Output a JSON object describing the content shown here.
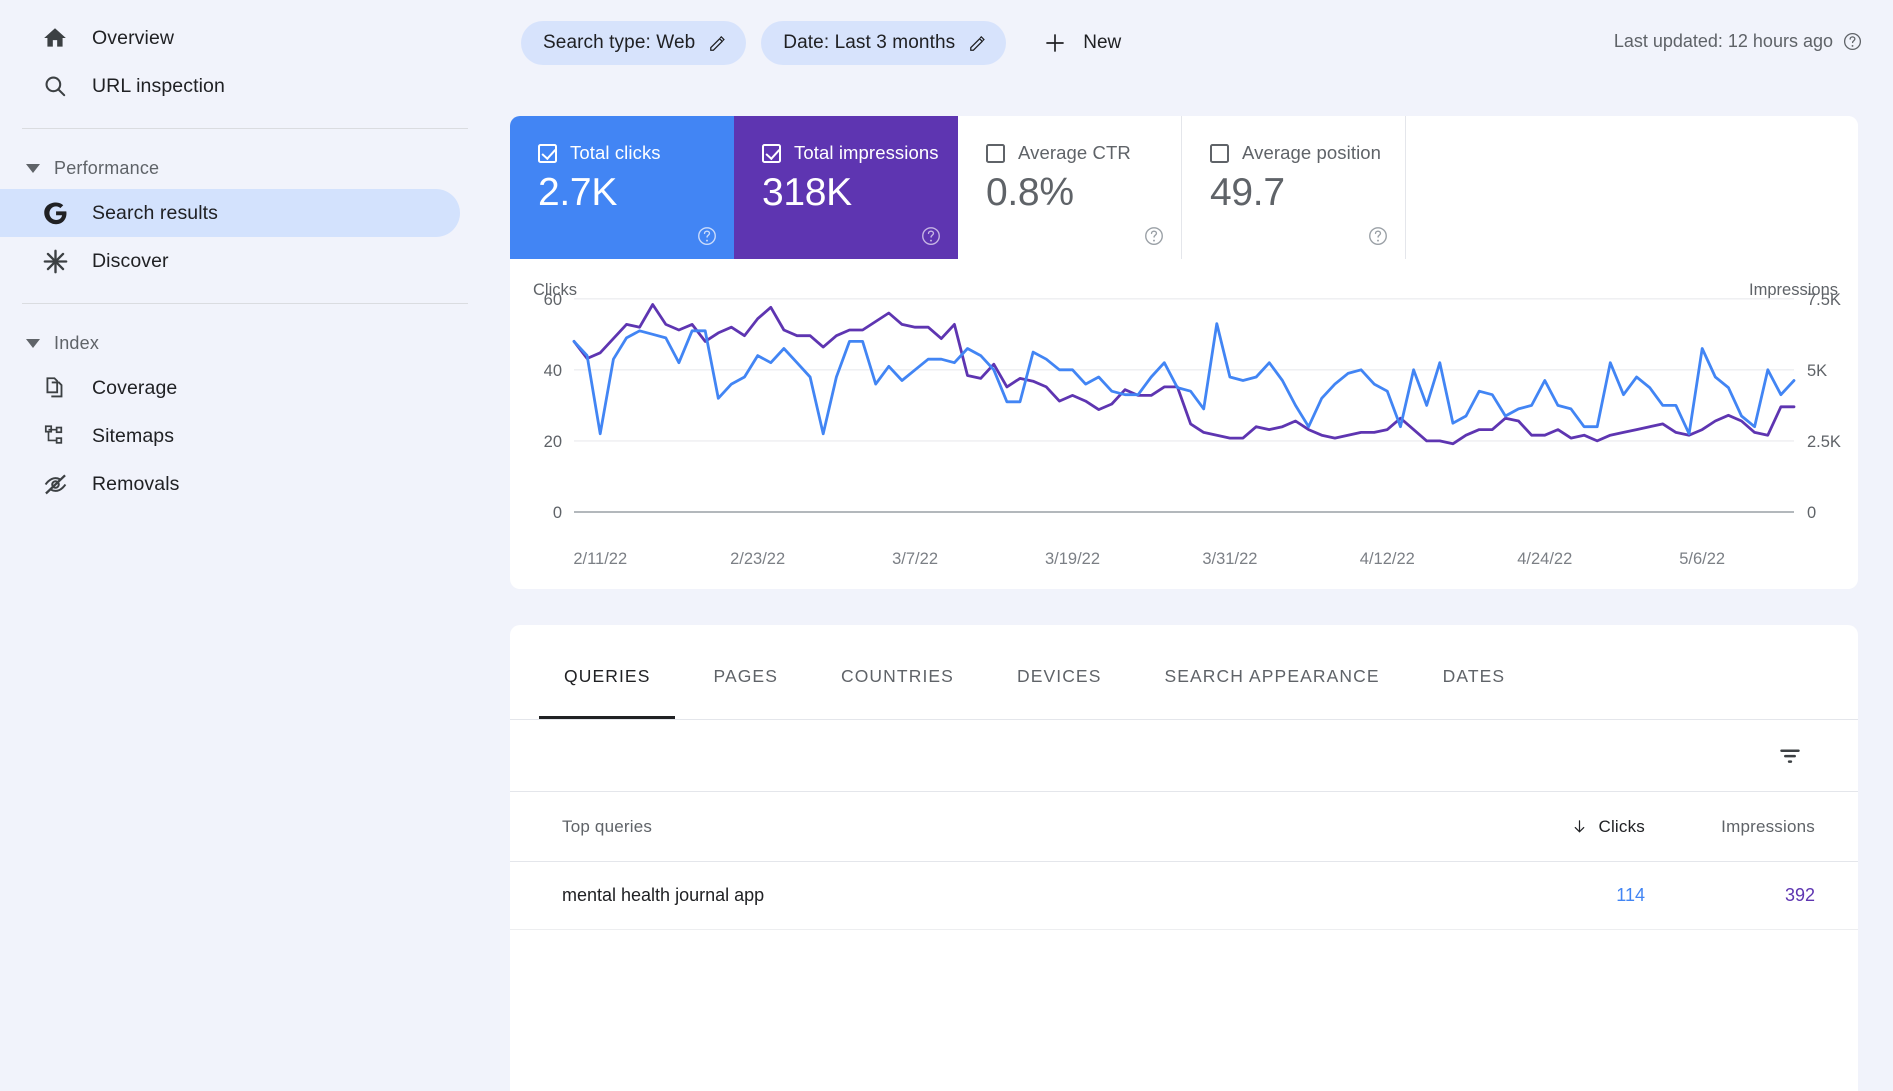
{
  "sidebar": {
    "items": [
      {
        "label": "Overview",
        "icon": "home-icon",
        "selected": false
      },
      {
        "label": "URL inspection",
        "icon": "search-icon",
        "selected": false
      }
    ],
    "sections": [
      {
        "label": "Performance",
        "items": [
          {
            "label": "Search results",
            "icon": "google-g-icon",
            "selected": true
          },
          {
            "label": "Discover",
            "icon": "asterisk-icon",
            "selected": false
          }
        ]
      },
      {
        "label": "Index",
        "items": [
          {
            "label": "Coverage",
            "icon": "documents-icon",
            "selected": false
          },
          {
            "label": "Sitemaps",
            "icon": "sitemap-icon",
            "selected": false
          },
          {
            "label": "Removals",
            "icon": "eye-off-icon",
            "selected": false
          }
        ]
      }
    ]
  },
  "filterbar": {
    "chips": [
      {
        "label": "Search type: Web",
        "icon": "pencil-icon"
      },
      {
        "label": "Date: Last 3 months",
        "icon": "pencil-icon"
      }
    ],
    "new_button": "New",
    "last_updated": "Last updated: 12 hours ago"
  },
  "metrics": [
    {
      "title": "Total clicks",
      "value": "2.7K",
      "checked": true,
      "style": "blue",
      "color": "#4285F4"
    },
    {
      "title": "Total impressions",
      "value": "318K",
      "checked": true,
      "style": "purple",
      "color": "#5E35B1"
    },
    {
      "title": "Average CTR",
      "value": "0.8%",
      "checked": false,
      "style": "plain",
      "color": "#5F6368"
    },
    {
      "title": "Average position",
      "value": "49.7",
      "checked": false,
      "style": "plain",
      "color": "#5F6368"
    }
  ],
  "chart_data": {
    "type": "line",
    "title": "",
    "xlabel": "",
    "grid": true,
    "legend_position": "none",
    "x_tick_labels": [
      "2/11/22",
      "2/23/22",
      "3/7/22",
      "3/19/22",
      "3/31/22",
      "4/12/22",
      "4/24/22",
      "5/6/22"
    ],
    "x_tick_indices": [
      2,
      14,
      26,
      38,
      50,
      62,
      74,
      86
    ],
    "axes": {
      "left": {
        "label": "Clicks",
        "ticks": [
          "0",
          "20",
          "40",
          "60"
        ],
        "tickvals": [
          0,
          20,
          40,
          60
        ],
        "ylim": [
          0,
          65
        ]
      },
      "right": {
        "label": "Impressions",
        "ticks": [
          "0",
          "2.5K",
          "5K",
          "7.5K"
        ],
        "tickvals": [
          0,
          2500,
          5000,
          7500
        ],
        "ylim": [
          0,
          8125
        ]
      }
    },
    "series": [
      {
        "name": "Clicks",
        "axis": "left",
        "color": "#4285F4",
        "values": [
          48,
          44,
          22,
          43,
          49,
          51,
          50,
          49,
          42,
          51,
          51,
          32,
          36,
          38,
          44,
          42,
          46,
          42,
          38,
          22,
          38,
          48,
          48,
          36,
          41,
          37,
          40,
          43,
          43,
          42,
          46,
          44,
          40,
          31,
          31,
          45,
          43,
          40,
          40,
          36,
          38,
          34,
          33,
          33,
          38,
          42,
          35,
          34,
          29,
          53,
          38,
          37,
          38,
          42,
          37,
          30,
          24,
          32,
          36,
          39,
          40,
          36,
          34,
          24,
          40,
          30,
          42,
          25,
          27,
          34,
          33,
          27,
          29,
          30,
          37,
          30,
          29,
          24,
          24,
          42,
          33,
          38,
          35,
          30,
          30,
          22,
          46,
          38,
          35,
          27,
          24,
          40,
          33,
          37
        ],
        "min": 22,
        "max": 53
      },
      {
        "name": "Impressions",
        "axis": "right",
        "color": "#5E35B1",
        "values": [
          6000,
          5400,
          5600,
          6100,
          6600,
          6500,
          7300,
          6600,
          6400,
          6600,
          6000,
          6300,
          6500,
          6200,
          6800,
          7200,
          6400,
          6200,
          6200,
          5800,
          6200,
          6400,
          6400,
          6700,
          7000,
          6600,
          6500,
          6500,
          6100,
          6600,
          4800,
          4700,
          5200,
          4400,
          4700,
          4600,
          4400,
          3900,
          4100,
          3900,
          3600,
          3800,
          4300,
          4100,
          4100,
          4400,
          4400,
          3100,
          2800,
          2700,
          2600,
          2600,
          3000,
          2900,
          3000,
          3200,
          2900,
          2700,
          2600,
          2700,
          2800,
          2800,
          2900,
          3300,
          2900,
          2500,
          2500,
          2400,
          2700,
          2900,
          2900,
          3300,
          3200,
          2700,
          2700,
          2900,
          2600,
          2700,
          2500,
          2700,
          2800,
          2900,
          3000,
          3100,
          2800,
          2700,
          2900,
          3200,
          3400,
          3200,
          2800,
          2700,
          3700,
          3700
        ],
        "min": 2400,
        "max": 7300
      }
    ]
  },
  "table": {
    "tabs": [
      {
        "label": "QUERIES",
        "active": true
      },
      {
        "label": "PAGES",
        "active": false
      },
      {
        "label": "COUNTRIES",
        "active": false
      },
      {
        "label": "DEVICES",
        "active": false
      },
      {
        "label": "SEARCH APPEARANCE",
        "active": false
      },
      {
        "label": "DATES",
        "active": false
      }
    ],
    "filter_icon": "filter-icon",
    "columns": {
      "query": "Top queries",
      "clicks": "Clicks",
      "impressions": "Impressions",
      "sort_icon": "arrow-down-icon"
    },
    "rows": [
      {
        "query": "mental health journal app",
        "clicks": "114",
        "impressions": "392"
      }
    ]
  }
}
